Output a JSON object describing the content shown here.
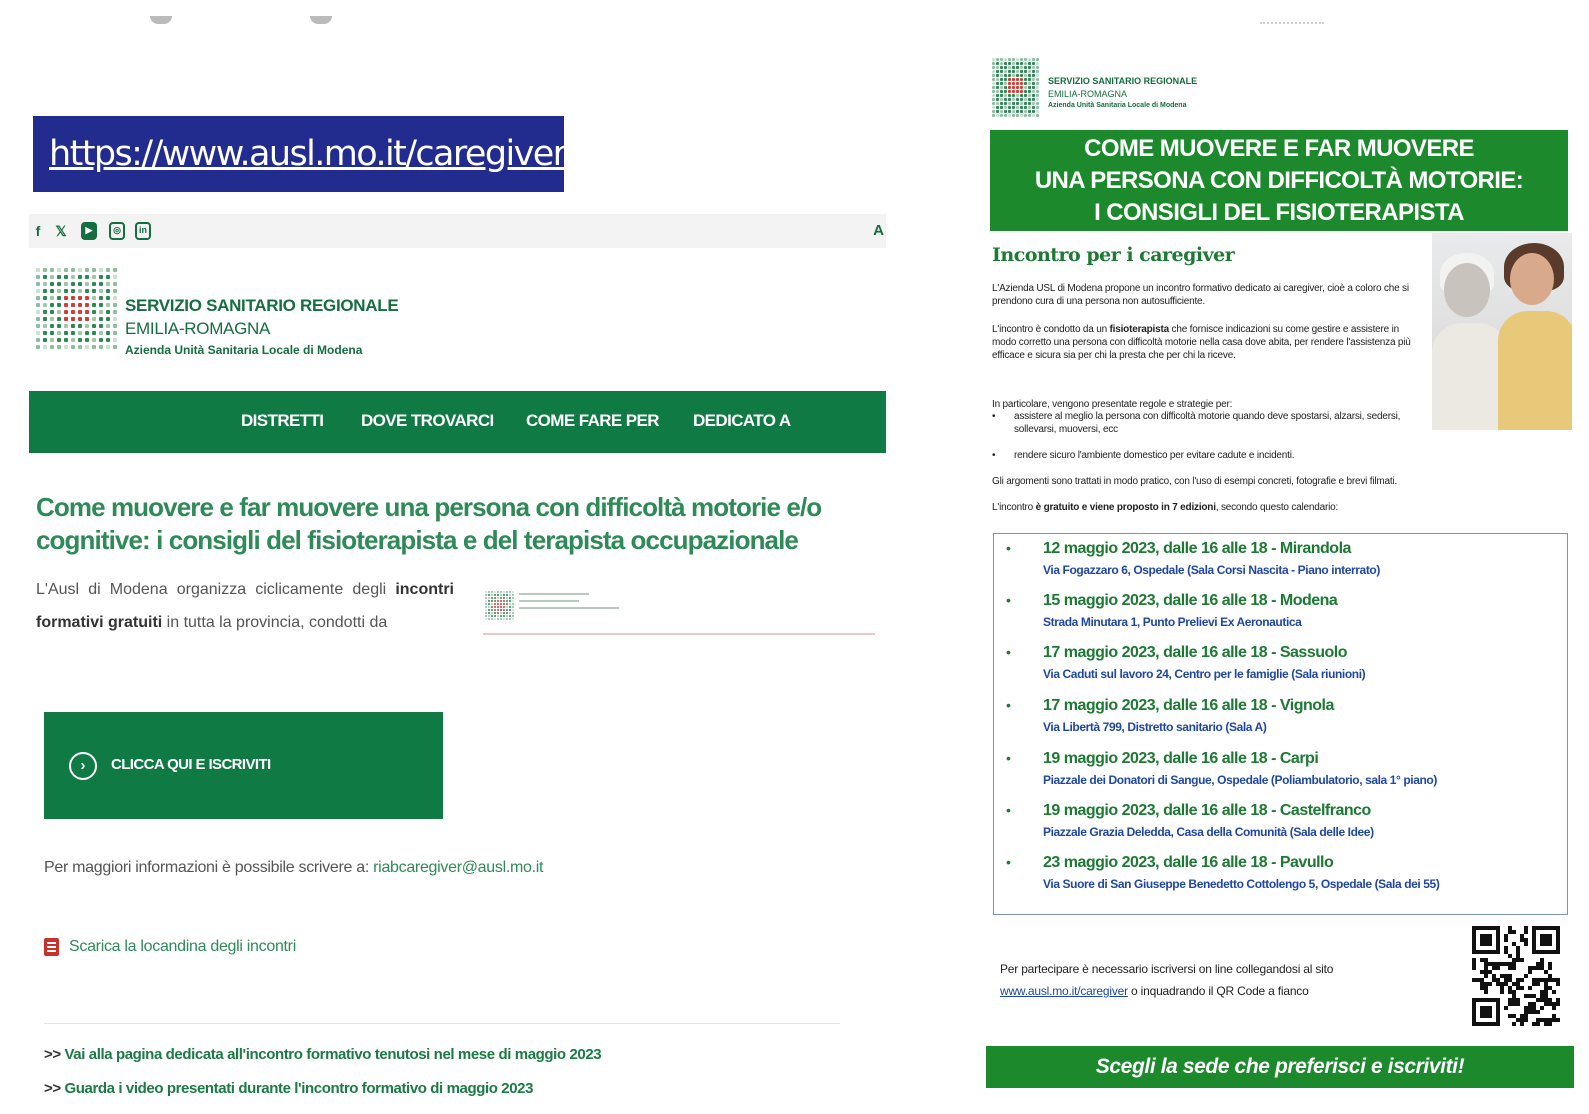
{
  "website": {
    "url_banner": "https://www.ausl.mo.it/caregiver",
    "social_icons": [
      "f",
      "𝕏",
      "▶",
      "◎",
      "in"
    ],
    "toolbar_corner": "A",
    "logo": {
      "line1": "SERVIZIO SANITARIO REGIONALE",
      "line2": "EMILIA-ROMAGNA",
      "line3": "Azienda Unità Sanitaria Locale di Modena"
    },
    "nav": [
      "DISTRETTI",
      "DOVE TROVARCI",
      "COME FARE PER",
      "DEDICATO A"
    ],
    "page_title": "Come muovere e far muovere una persona con difficoltà motorie e/o cognitive: i consigli del fisioterapista e del terapista occupazionale",
    "intro": {
      "t1": "L'Ausl di Modena organizza ciclicamente degli ",
      "b1": "incontri formativi gratuiti",
      "t2": " in tutta la provincia, condotti da"
    },
    "cta_label": "CLICCA QUI E ISCRIVITI",
    "info_text": "Per maggiori informazioni è possibile scrivere a: ",
    "info_email": "riabcaregiver@ausl.mo.it",
    "download_label": "Scarica la locandina degli incontri",
    "links": [
      {
        "prefix": ">> ",
        "label": "Vai alla pagina dedicata all'incontro formativo tenutosi nel mese di maggio 2023"
      },
      {
        "prefix": ">> ",
        "label": "Guarda i video presentati durante l'incontro formativo di maggio 2023"
      }
    ],
    "colors": {
      "accent_green": "#0f7a44",
      "banner_blue": "#222c8f",
      "title_green": "#2e8a57"
    }
  },
  "flyer": {
    "logo": {
      "line1": "SERVIZIO SANITARIO REGIONALE",
      "line2": "EMILIA-ROMAGNA",
      "line3": "Azienda Unità Sanitaria Locale di Modena"
    },
    "header": [
      "COME MUOVERE E FAR MUOVERE",
      "UNA PERSONA CON DIFFICOLTÀ MOTORIE:",
      "I CONSIGLI DEL FISIOTERAPISTA"
    ],
    "subtitle": "Incontro per i caregiver",
    "p1": "L'Azienda USL di Modena propone un incontro formativo dedicato ai caregiver, cioè a coloro che si prendono cura di una persona non autosufficiente.",
    "p2_a": "L'incontro è condotto da un ",
    "p2_b": "fisioterapista",
    "p2_c": " che fornisce indicazioni su come gestire e assistere in modo corretto una persona con difficoltà motorie nella casa dove abita, per rendere l'assistenza più efficace e sicura sia per chi la presta che per chi la riceve.",
    "p3": "In particolare, vengono presentate regole e strategie per:",
    "bullets": [
      "assistere al meglio la persona con difficoltà motorie quando deve spostarsi, alzarsi, sedersi, sollevarsi, muoversi, ecc",
      "rendere sicuro l'ambiente domestico per evitare cadute e incidenti."
    ],
    "p4": "Gli argomenti sono trattati in modo pratico, con l'uso di esempi concreti, fotografie e brevi filmati.",
    "p5_a": "L'incontro ",
    "p5_b": "è gratuito e viene proposto in 7 edizioni",
    "p5_c": ", secondo questo calendario:",
    "calendar": [
      {
        "date": "12 maggio 2023, dalle 16 alle 18 - Mirandola",
        "place": "Via Fogazzaro 6, Ospedale (Sala Corsi Nascita - Piano interrato)"
      },
      {
        "date": "15 maggio 2023, dalle 16 alle 18 - Modena",
        "place": "Strada Minutara 1, Punto Prelievi Ex Aeronautica"
      },
      {
        "date": "17 maggio 2023, dalle 16 alle 18 - Sassuolo",
        "place": "Via Caduti sul lavoro 24, Centro per le famiglie (Sala riunioni)"
      },
      {
        "date": "17 maggio 2023, dalle 16 alle 18 - Vignola",
        "place": "Via Libertà 799, Distretto sanitario (Sala A)"
      },
      {
        "date": "19 maggio 2023, dalle 16 alle 18 - Carpi",
        "place": "Piazzale dei Donatori di Sangue, Ospedale (Poliambulatorio, sala 1° piano)"
      },
      {
        "date": "19 maggio 2023, dalle 16 alle 18 - Castelfranco",
        "place": "Piazzale Grazia Deledda, Casa della Comunità (Sala delle Idee)"
      },
      {
        "date": "23 maggio 2023, dalle 16 alle 18 - Pavullo",
        "place": "Via Suore di San Giuseppe Benedetto Cottolengo 5, Ospedale (Sala dei 55)"
      }
    ],
    "register_a": "Per partecipare è necessario iscriversi on line collegandosi al sito",
    "register_link": "www.ausl.mo.it/caregiver",
    "register_b": " o inquadrando il QR Code a fianco",
    "footer": "Scegli la sede che preferisci e iscriviti!",
    "colors": {
      "header_green": "#1c8a2c",
      "place_blue": "#1f47a8"
    }
  }
}
